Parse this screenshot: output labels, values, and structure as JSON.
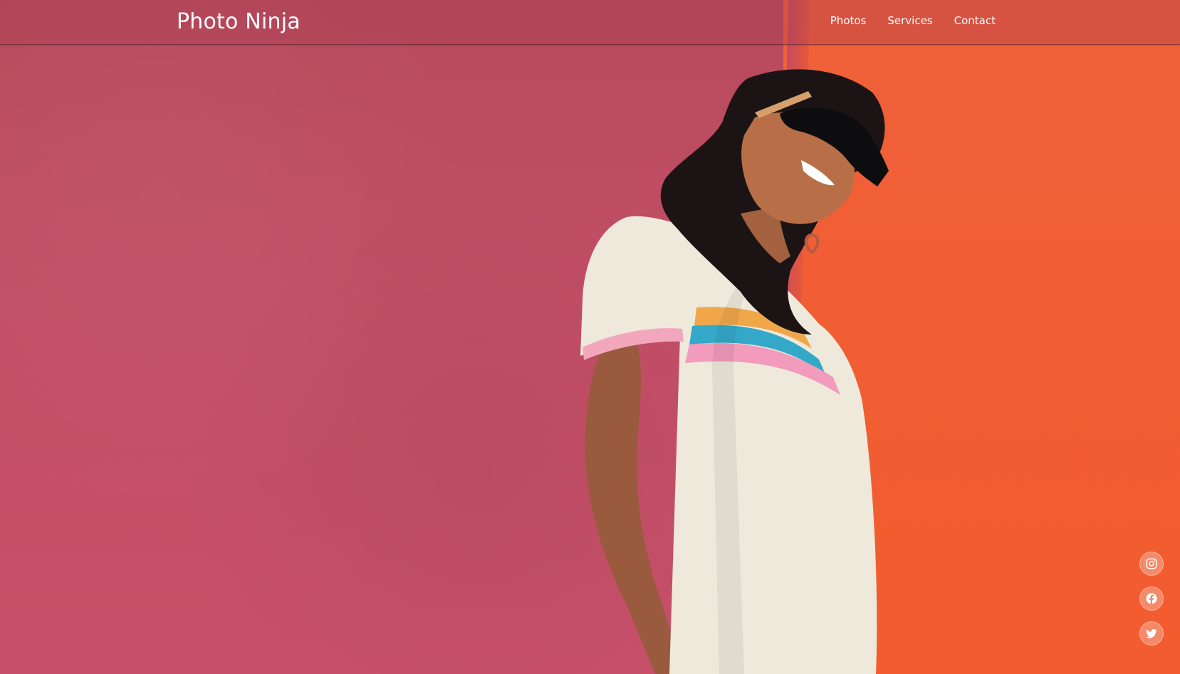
{
  "header": {
    "brand": "Photo Ninja",
    "nav": [
      {
        "label": "Photos"
      },
      {
        "label": "Services"
      },
      {
        "label": "Contact"
      }
    ]
  },
  "social": [
    {
      "icon": "instagram-icon"
    },
    {
      "icon": "facebook-icon"
    },
    {
      "icon": "twitter-icon"
    }
  ],
  "colors": {
    "wall_left": "#c24e66",
    "wall_right": "#f25c2e",
    "header_overlay": "#aa3c50",
    "text": "#ffffff"
  }
}
